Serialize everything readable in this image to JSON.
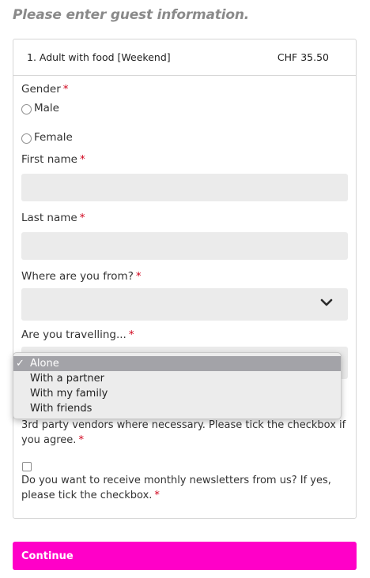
{
  "heading": "Please enter guest information.",
  "ticket": {
    "name": "1. Adult with food [Weekend]",
    "price": "CHF 35.50"
  },
  "required_mark": "*",
  "gender": {
    "label": "Gender",
    "options": [
      "Male",
      "Female"
    ]
  },
  "first_name": {
    "label": "First name",
    "value": ""
  },
  "last_name": {
    "label": "Last name",
    "value": ""
  },
  "origin": {
    "label": "Where are you from?",
    "selected": ""
  },
  "travelling": {
    "label": "Are you travelling...",
    "options": [
      "Alone",
      "With a partner",
      "With my family",
      "With friends"
    ],
    "selected": "Alone"
  },
  "vendors_text": "3rd party vendors where necessary. Please tick the checkbox if you agree.",
  "newsletter_text": "Do you want to receive monthly newsletters from us? If yes, please tick the checkbox.",
  "continue_label": "Continue",
  "colors": {
    "accent": "#ff00c8",
    "required": "#d0021b",
    "field_bg": "#ebebeb"
  },
  "icons": {
    "select_arrow": "chevron-down-icon",
    "selected_option": "checkmark-icon"
  }
}
